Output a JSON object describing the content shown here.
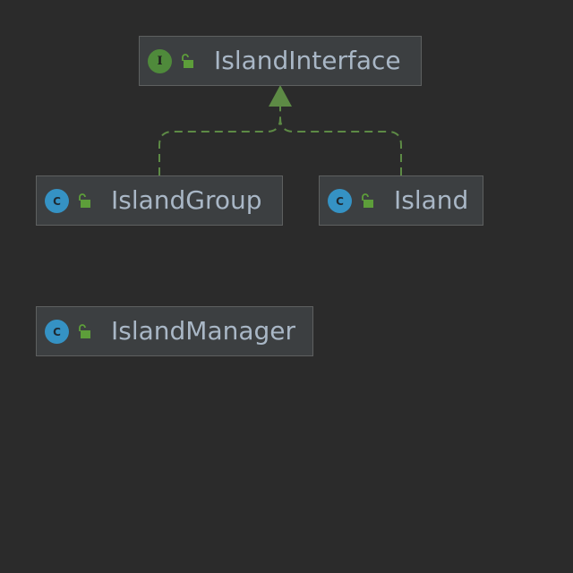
{
  "diagram": {
    "nodes": [
      {
        "id": "islandinterface",
        "kind": "interface",
        "badge": "I",
        "name": "IslandInterface",
        "visibility_icon": "unlocked-padlock-icon"
      },
      {
        "id": "islandgroup",
        "kind": "class",
        "badge": "C",
        "name": "IslandGroup",
        "visibility_icon": "unlocked-padlock-icon"
      },
      {
        "id": "island",
        "kind": "class",
        "badge": "C",
        "name": "Island",
        "visibility_icon": "unlocked-padlock-icon"
      },
      {
        "id": "islandmanager",
        "kind": "class",
        "badge": "C",
        "name": "IslandManager",
        "visibility_icon": "unlocked-padlock-icon"
      }
    ],
    "edges": [
      {
        "from": "IslandGroup",
        "to": "IslandInterface",
        "type": "implements"
      },
      {
        "from": "Island",
        "to": "IslandInterface",
        "type": "implements"
      }
    ]
  },
  "colors": {
    "background": "#2b2b2b",
    "node_fill": "#3c3f41",
    "node_border": "#5e6060",
    "label_text": "#a9b7c6",
    "interface_badge": "#4f8a3b",
    "class_badge": "#3592c4",
    "implements_edge": "#5d8a45"
  }
}
